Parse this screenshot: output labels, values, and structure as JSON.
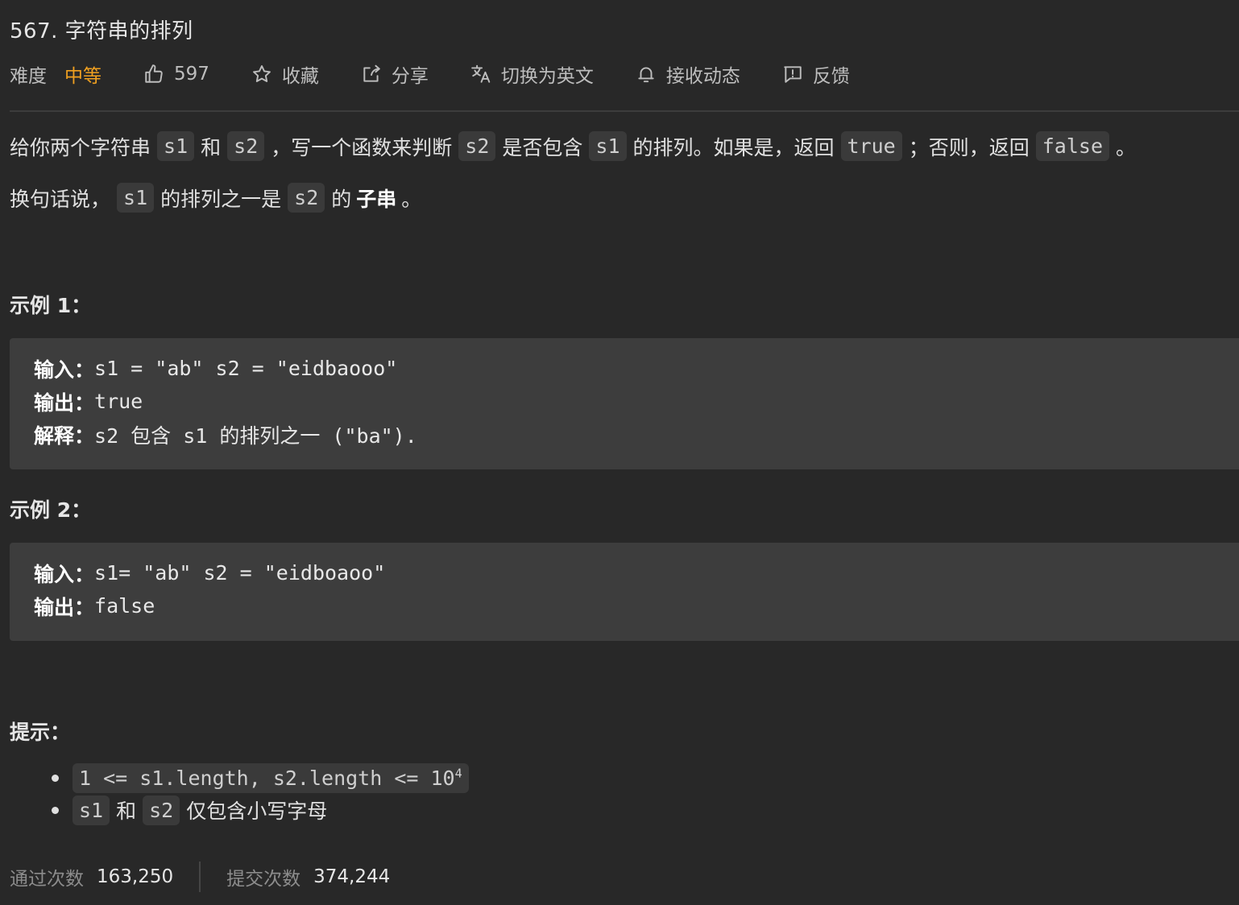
{
  "problem": {
    "title": "567. 字符串的排列",
    "difficulty_label": "难度",
    "difficulty_value": "中等"
  },
  "toolbar": {
    "like_count": "597",
    "favorite": "收藏",
    "share": "分享",
    "switch_lang": "切换为英文",
    "notify": "接收动态",
    "feedback": "反馈"
  },
  "description": {
    "p1": {
      "t1": "给你两个字符串",
      "c1": "s1",
      "t2": "和",
      "c2": "s2",
      "t3": "，写一个函数来判断",
      "c3": "s2",
      "t4": "是否包含",
      "c4": "s1",
      "t5": "的排列。如果是，返回",
      "c5": "true",
      "t6": "；否则，返回",
      "c6": "false",
      "t7": "。"
    },
    "p2": {
      "t1": "换句话说，",
      "c1": "s1",
      "t2": "的排列之一是",
      "c2": "s2",
      "t3": "的",
      "b1": "子串",
      "t4": "。"
    }
  },
  "examples": [
    {
      "title": "示例 1：",
      "input_label": "输入：",
      "input_value": "s1 = \"ab\" s2 = \"eidbaooo\"",
      "output_label": "输出：",
      "output_value": "true",
      "explain_label": "解释：",
      "explain_value": "s2 包含 s1 的排列之一 (\"ba\")."
    },
    {
      "title": "示例 2：",
      "input_label": "输入：",
      "input_value": "s1= \"ab\" s2 = \"eidboaoo\"",
      "output_label": "输出：",
      "output_value": "false"
    }
  ],
  "hints": {
    "title": "提示：",
    "h1_code": "1 <= s1.length, s2.length <= 10",
    "h1_sup": "4",
    "h2_c1": "s1",
    "h2_t1": "和",
    "h2_c2": "s2",
    "h2_t2": "仅包含小写字母"
  },
  "stats": {
    "accepted_label": "通过次数",
    "accepted_value": "163,250",
    "submitted_label": "提交次数",
    "submitted_value": "374,244"
  },
  "icons": {
    "like": "thumbs-up-icon",
    "favorite": "star-icon",
    "share": "share-icon",
    "translate": "translate-icon",
    "bell": "bell-icon",
    "feedback": "feedback-icon"
  },
  "colors": {
    "background": "#282828",
    "difficulty_medium": "#f0a020",
    "code_bg": "#3a3a3a",
    "example_bg": "#3d3d3d"
  }
}
